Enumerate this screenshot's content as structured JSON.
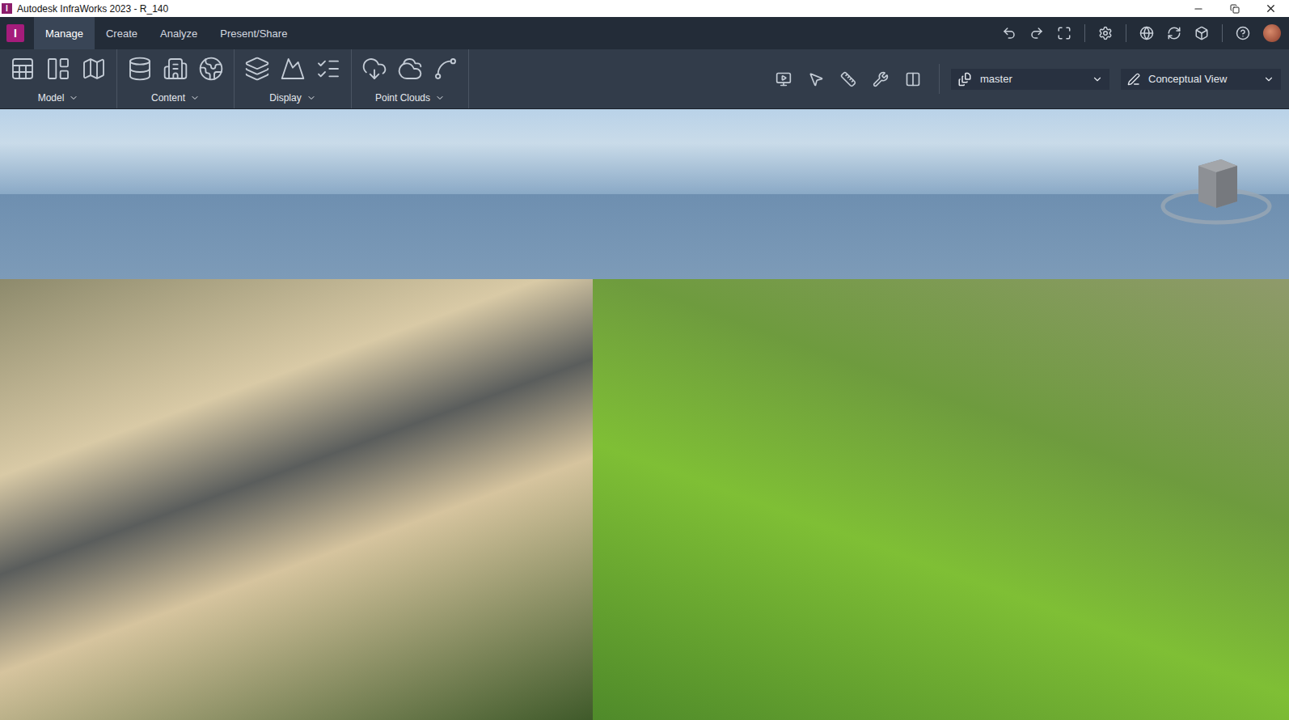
{
  "window": {
    "title": "Autodesk InfraWorks 2023 - R_140",
    "app_icon": "I"
  },
  "tabs": [
    {
      "label": "Manage",
      "selected": true
    },
    {
      "label": "Create",
      "selected": false
    },
    {
      "label": "Analyze",
      "selected": false
    },
    {
      "label": "Present/Share",
      "selected": false
    }
  ],
  "ribbon_groups": [
    {
      "label": "Model"
    },
    {
      "label": "Content"
    },
    {
      "label": "Display"
    },
    {
      "label": "Point Clouds"
    }
  ],
  "proposal_dropdown": {
    "value": "master"
  },
  "view_dropdown": {
    "value": "Conceptual View"
  }
}
